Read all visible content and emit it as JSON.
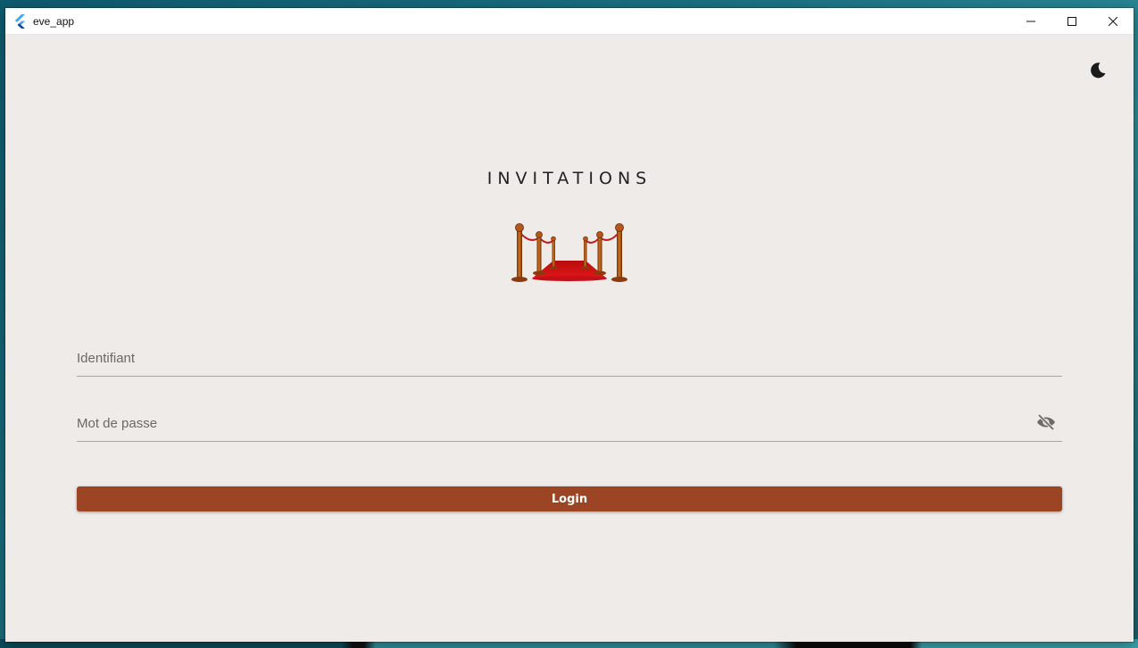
{
  "window": {
    "title": "eve_app",
    "app_icon": "flutter-logo-icon",
    "controls": [
      "minimize-icon",
      "maximize-icon",
      "close-icon"
    ]
  },
  "header": {
    "theme_toggle_icon": "moon-icon"
  },
  "main": {
    "title": "INVITATIONS",
    "illustration": "red-carpet-icon",
    "username": {
      "placeholder": "Identifiant",
      "value": ""
    },
    "password": {
      "placeholder": "Mot de passe",
      "value": "",
      "visibility_icon": "eye-off-icon"
    },
    "login_label": "Login"
  },
  "colors": {
    "background": "#efebe8",
    "accent": "#9c4524",
    "titlebar": "#ffffff",
    "text": "#222222"
  }
}
